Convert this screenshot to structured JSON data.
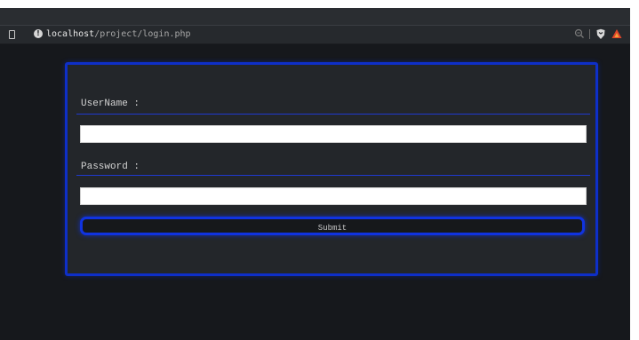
{
  "browser": {
    "url_host": "localhost",
    "url_path": "/project/login.php"
  },
  "form": {
    "username_label": "UserName :",
    "username_value": "",
    "password_label": "Password :",
    "password_value": "",
    "submit_label": "Submit"
  },
  "colors": {
    "page_background": "#16181c",
    "card_background": "#23262a",
    "accent_blue": "#0e2fc8"
  }
}
